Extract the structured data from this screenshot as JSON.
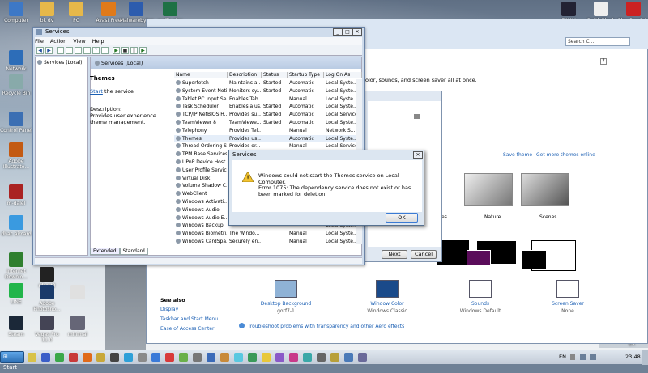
{
  "desktop": {
    "icons_left": [
      {
        "label": "Computer",
        "icon": "computer-icon",
        "color": "#3d78c6"
      },
      {
        "label": "Network",
        "icon": "network-icon",
        "color": "#2d6db8"
      },
      {
        "label": "Recycle Bin",
        "icon": "recycle-bin-icon",
        "color": "#8aa"
      },
      {
        "label": "Control Panel",
        "icon": "control-panel-icon",
        "color": "#3b6fb3"
      },
      {
        "label": "Adobe Illustrato...",
        "icon": "adobe-icon",
        "color": "#c35a12"
      },
      {
        "label": "m-dalel",
        "icon": "app-icon",
        "color": "#aa2222"
      },
      {
        "label": "dhac aircard",
        "icon": "app-icon",
        "color": "#3a9ae0"
      },
      {
        "label": "Internet Downlo...",
        "icon": "idm-icon",
        "color": "#2f7f2f"
      },
      {
        "label": "LINE",
        "icon": "line-icon",
        "color": "#21b54a"
      },
      {
        "label": "Steam",
        "icon": "steam-icon",
        "color": "#1b2838"
      }
    ],
    "icons_top": [
      {
        "label": "bk dv",
        "color": "#e6b84a"
      },
      {
        "label": "PC",
        "color": "#e6b84a"
      },
      {
        "label": "Avast Free",
        "color": "#e07a1a"
      },
      {
        "label": "Malwarebytes",
        "color": "#2c5cae"
      },
      {
        "label": "audit .xlsx",
        "color": "#1e7145"
      }
    ],
    "icons_col2": [
      {
        "label": "nfsmt2",
        "color": "#222"
      },
      {
        "label": "Adobe Photosho...",
        "color": "#1a3a6a"
      },
      {
        "label": "Vegas Pro 11.0",
        "color": "#445"
      }
    ],
    "icons_col3": [
      {
        "label": "",
        "color": "#e0e0e0"
      },
      {
        "label": "minimal",
        "color": "#667"
      }
    ],
    "icons_right": [
      {
        "label": "DNAV",
        "color": "#223"
      },
      {
        "label": "BattleBlock",
        "color": "#eee"
      },
      {
        "label": "Play PandaJe",
        "color": "#c22"
      },
      {
        "label": "Stardew Valley",
        "color": "#7ab"
      }
    ],
    "ex_label": "EX"
  },
  "personalization": {
    "search_placeholder": "Search C...",
    "intro_text": "olor, sounds, and screen saver all at once.",
    "save_theme": "Save theme",
    "get_more": "Get more themes online",
    "theme_names": [
      "es",
      "Nature",
      "Scenes"
    ],
    "bottom_items": [
      {
        "label": "Desktop Background",
        "sub": "gotf7-1",
        "icon": "desktop-background-icon"
      },
      {
        "label": "Window Color",
        "sub": "Windows Classic",
        "icon": "window-color-icon"
      },
      {
        "label": "Sounds",
        "sub": "Windows Default",
        "icon": "sounds-icon"
      },
      {
        "label": "Screen Saver",
        "sub": "None",
        "icon": "screen-saver-icon"
      }
    ],
    "see_also": "See also",
    "see_also_links": [
      "Display",
      "Taskbar and Start Menu",
      "Ease of Access Center"
    ],
    "troubleshoot": "Troubleshoot problems with transparency and other Aero effects"
  },
  "services": {
    "title": "Services",
    "menu": [
      "File",
      "Action",
      "View",
      "Help"
    ],
    "tree_item": "Services (Local)",
    "pane_title": "Services (Local)",
    "detail_name": "Themes",
    "start_link": "Start",
    "start_rest": " the service",
    "desc_label": "Description:",
    "desc_text": "Provides user experience theme management.",
    "columns": [
      "Name",
      "Description",
      "Status",
      "Startup Type",
      "Log On As"
    ],
    "rows": [
      [
        "Superfetch",
        "Maintains a...",
        "Started",
        "Automatic",
        "Local Syste..."
      ],
      [
        "System Event Noti...",
        "Monitors sy...",
        "Started",
        "Automatic",
        "Local Syste..."
      ],
      [
        "Tablet PC Input Se...",
        "Enables Tab...",
        "",
        "Manual",
        "Local Syste..."
      ],
      [
        "Task Scheduler",
        "Enables a us...",
        "Started",
        "Automatic",
        "Local Syste..."
      ],
      [
        "TCP/IP NetBIOS H...",
        "Provides su...",
        "Started",
        "Automatic",
        "Local Service"
      ],
      [
        "TeamViewer 8",
        "TeamViewe...",
        "Started",
        "Automatic",
        "Local Syste..."
      ],
      [
        "Telephony",
        "Provides Tel...",
        "",
        "Manual",
        "Network S..."
      ],
      [
        "Themes",
        "Provides us...",
        "",
        "Automatic",
        "Local Syste..."
      ],
      [
        "Thread Ordering S...",
        "Provides or...",
        "",
        "Manual",
        "Local Service"
      ],
      [
        "TPM Base Services",
        "",
        "",
        "",
        "Local Service"
      ],
      [
        "UPnP Device Host",
        "",
        "",
        "",
        "Local Service"
      ],
      [
        "User Profile Service",
        "",
        "",
        "",
        "Local Syste..."
      ],
      [
        "Virtual Disk",
        "",
        "",
        "",
        "Local Syste..."
      ],
      [
        "Volume Shadow C...",
        "",
        "",
        "",
        "Local Syste..."
      ],
      [
        "WebClient",
        "",
        "",
        "",
        "Local Service"
      ],
      [
        "Windows Activati...",
        "",
        "",
        "",
        "Network S..."
      ],
      [
        "Windows Audio",
        "",
        "",
        "",
        "Local Service"
      ],
      [
        "Windows Audio E...",
        "",
        "",
        "",
        "Local Syste..."
      ],
      [
        "Windows Backup",
        "",
        "",
        "",
        "Local Syste..."
      ],
      [
        "Windows Biometri...",
        "The Windo...",
        "",
        "Manual",
        "Local Syste..."
      ],
      [
        "Windows CardSpa...",
        "Securely en...",
        "",
        "Manual",
        "Local Syste..."
      ]
    ],
    "tab_extended": "Extended",
    "tab_standard": "Standard"
  },
  "error_dialog": {
    "title": "Services",
    "message": "Windows could not start the Themes service on Local Computer.",
    "detail": "Error 1075: The dependency service does not exist or has been marked for deletion.",
    "ok": "OK"
  },
  "back_dialog": {
    "next": "Next",
    "cancel": "Cancel"
  },
  "taskbar": {
    "start": "Start",
    "lang": "EN",
    "time": "23:48"
  }
}
